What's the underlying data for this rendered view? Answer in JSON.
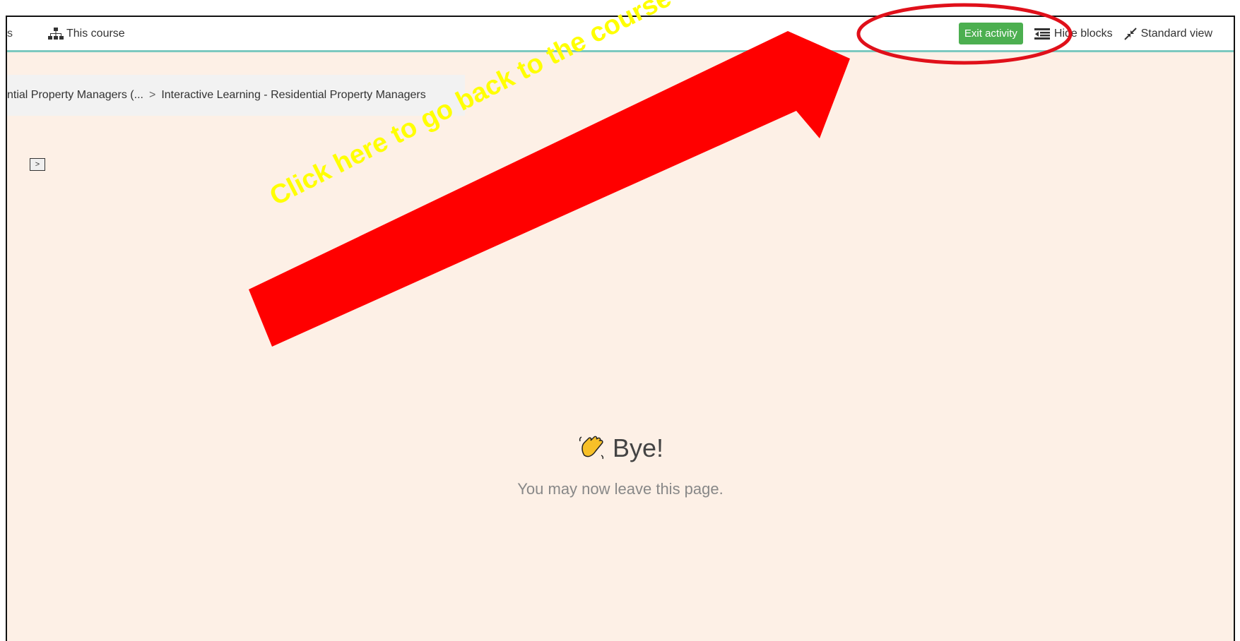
{
  "topbar": {
    "cut_text": "s",
    "this_course": "This course",
    "exit_activity": "Exit activity",
    "hide_blocks": "Hide blocks",
    "standard_view": "Standard view"
  },
  "breadcrumb": {
    "items": [
      "ntial Property Managers (...",
      "Interactive Learning - Residential Property Managers"
    ],
    "separator": ">"
  },
  "expand_button": ">",
  "main": {
    "title": "Bye!",
    "subtitle": "You may now leave this page."
  },
  "annotation": {
    "text": "Click here to go back to the course dashboard",
    "arrow_color": "#ff0000",
    "text_color": "#ffff00",
    "circle_color": "#e0101a"
  },
  "colors": {
    "accent": "#4caf50",
    "topbar_border": "#7cc9c0",
    "content_bg": "#fdf0e6"
  }
}
